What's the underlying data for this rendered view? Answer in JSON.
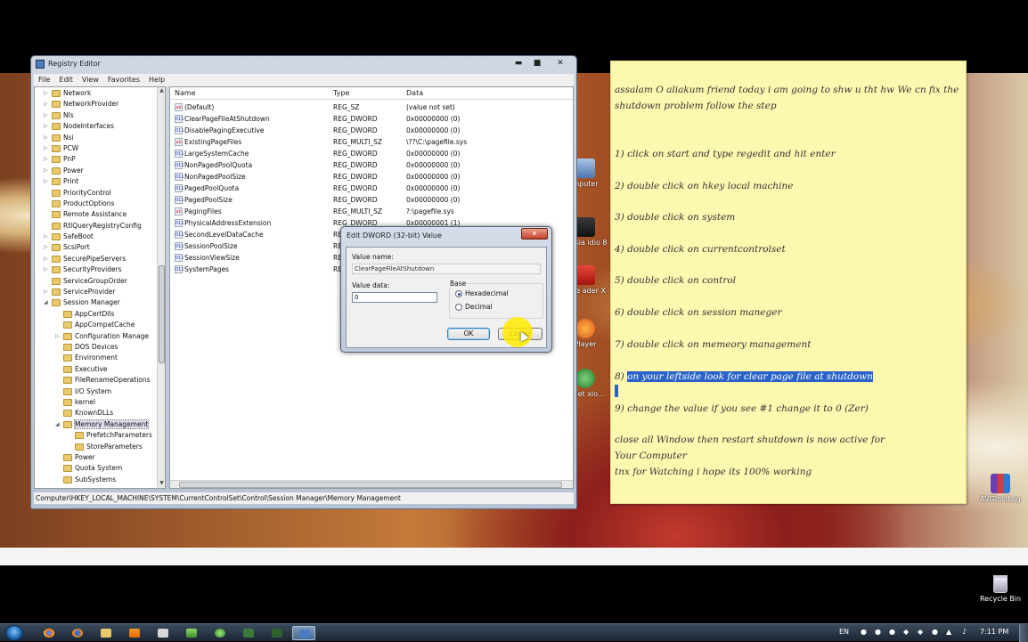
{
  "registry_editor": {
    "title": "Registry Editor",
    "window_buttons": {
      "minimize": "▬",
      "maximize": "■",
      "close": "✕"
    },
    "menu": [
      "File",
      "Edit",
      "View",
      "Favorites",
      "Help"
    ],
    "tree": [
      {
        "label": "Network",
        "exp": "▷"
      },
      {
        "label": "NetworkProvider",
        "exp": "▷"
      },
      {
        "label": "Nls",
        "exp": "▷"
      },
      {
        "label": "NodeInterfaces",
        "exp": "▷"
      },
      {
        "label": "Nsi",
        "exp": "▷"
      },
      {
        "label": "PCW",
        "exp": "▷"
      },
      {
        "label": "PnP",
        "exp": "▷"
      },
      {
        "label": "Power",
        "exp": "▷"
      },
      {
        "label": "Print",
        "exp": "▷"
      },
      {
        "label": "PriorityControl",
        "exp": ""
      },
      {
        "label": "ProductOptions",
        "exp": ""
      },
      {
        "label": "Remote Assistance",
        "exp": ""
      },
      {
        "label": "RtlQueryRegistryConfig",
        "exp": ""
      },
      {
        "label": "SafeBoot",
        "exp": "▷"
      },
      {
        "label": "ScsiPort",
        "exp": "▷"
      },
      {
        "label": "SecurePipeServers",
        "exp": "▷"
      },
      {
        "label": "SecurityProviders",
        "exp": "▷"
      },
      {
        "label": "ServiceGroupOrder",
        "exp": ""
      },
      {
        "label": "ServiceProvider",
        "exp": "▷"
      },
      {
        "label": "Session Manager",
        "exp": "◢"
      },
      {
        "label": "AppCertDlls",
        "exp": ""
      },
      {
        "label": "AppCompatCache",
        "exp": ""
      },
      {
        "label": "Configuration Manage",
        "exp": "▷"
      },
      {
        "label": "DOS Devices",
        "exp": ""
      },
      {
        "label": "Environment",
        "exp": ""
      },
      {
        "label": "Executive",
        "exp": ""
      },
      {
        "label": "FileRenameOperations",
        "exp": ""
      },
      {
        "label": "I/O System",
        "exp": ""
      },
      {
        "label": "kernel",
        "exp": ""
      },
      {
        "label": "KnownDLLs",
        "exp": ""
      },
      {
        "label": "Memory Management",
        "exp": "◢"
      },
      {
        "label": "PrefetchParameters",
        "exp": ""
      },
      {
        "label": "StoreParameters",
        "exp": ""
      },
      {
        "label": "Power",
        "exp": ""
      },
      {
        "label": "Quota System",
        "exp": ""
      },
      {
        "label": "SubSystems",
        "exp": ""
      }
    ],
    "columns": {
      "name": "Name",
      "type": "Type",
      "data": "Data"
    },
    "values": [
      {
        "name": "(Default)",
        "type": "REG_SZ",
        "data": "(value not set)",
        "icon": "ab"
      },
      {
        "name": "ClearPageFileAtShutdown",
        "type": "REG_DWORD",
        "data": "0x00000000 (0)",
        "icon": "011"
      },
      {
        "name": "DisablePagingExecutive",
        "type": "REG_DWORD",
        "data": "0x00000000 (0)",
        "icon": "011"
      },
      {
        "name": "ExistingPageFiles",
        "type": "REG_MULTI_SZ",
        "data": "\\??\\C:\\pagefile.sys",
        "icon": "ab"
      },
      {
        "name": "LargeSystemCache",
        "type": "REG_DWORD",
        "data": "0x00000000 (0)",
        "icon": "011"
      },
      {
        "name": "NonPagedPoolQuota",
        "type": "REG_DWORD",
        "data": "0x00000000 (0)",
        "icon": "011"
      },
      {
        "name": "NonPagedPoolSize",
        "type": "REG_DWORD",
        "data": "0x00000000 (0)",
        "icon": "011"
      },
      {
        "name": "PagedPoolQuota",
        "type": "REG_DWORD",
        "data": "0x00000000 (0)",
        "icon": "011"
      },
      {
        "name": "PagedPoolSize",
        "type": "REG_DWORD",
        "data": "0x00000000 (0)",
        "icon": "011"
      },
      {
        "name": "PagingFiles",
        "type": "REG_MULTI_SZ",
        "data": "?:\\pagefile.sys",
        "icon": "ab"
      },
      {
        "name": "PhysicalAddressExtension",
        "type": "REG_DWORD",
        "data": "0x00000001 (1)",
        "icon": "011"
      },
      {
        "name": "SecondLevelDataCache",
        "type": "REG_DWORD",
        "data": "0x00000000 (0)",
        "icon": "011"
      },
      {
        "name": "SessionPoolSize",
        "type": "REG",
        "data": "",
        "icon": "011"
      },
      {
        "name": "SessionViewSize",
        "type": "REG",
        "data": "",
        "icon": "011"
      },
      {
        "name": "SystemPages",
        "type": "REG",
        "data": "",
        "icon": "011"
      }
    ],
    "status_path": "Computer\\HKEY_LOCAL_MACHINE\\SYSTEM\\CurrentControlSet\\Control\\Session Manager\\Memory Management"
  },
  "dialog": {
    "title": "Edit DWORD (32-bit) Value",
    "close": "✕",
    "value_name_label": "Value name:",
    "value_name": "ClearPageFileAtShutdown",
    "value_data_label": "Value data:",
    "value_data": "0",
    "base_label": "Base",
    "base_options": [
      "Hexadecimal",
      "Decimal"
    ],
    "base_selected": "Hexadecimal",
    "ok": "OK",
    "cancel": "Cancel"
  },
  "note": {
    "lines": [
      "assalam O aliakum friend today i am going to shw u tht hw We cn fix the",
      "shutdown problem follow the step",
      "1) click on start and type regedit and hit enter",
      "2) double click on hkey local machine",
      "3) double click on system",
      "4) double click on currentcontrolset",
      "5) double click on control",
      "6) double click on session maneger",
      "7) double click on memeory management",
      "8) ",
      "9) change the value if you see #1 change it to 0 (Zer)",
      "close all Window then restart shutdown is now active for",
      "Your Computer",
      "tnx for Watching i hope its 100% working"
    ],
    "highlighted": "on your leftside look for clear page file at shutdown"
  },
  "desktop_icons": [
    "mputer",
    "ntasia\nidio 8",
    "lobe\nader X",
    "Player",
    "ernet\nxlo...",
    "AVGInstLog"
  ],
  "recycle_bin": "Recycle Bin",
  "taskbar": {
    "language": "EN",
    "clock": "7:11 PM",
    "apps": [
      "chrome",
      "firefox",
      "explorer",
      "vlc",
      "media",
      "messenger",
      "utorrent",
      "terminal",
      "terminal2",
      "regedit"
    ]
  }
}
